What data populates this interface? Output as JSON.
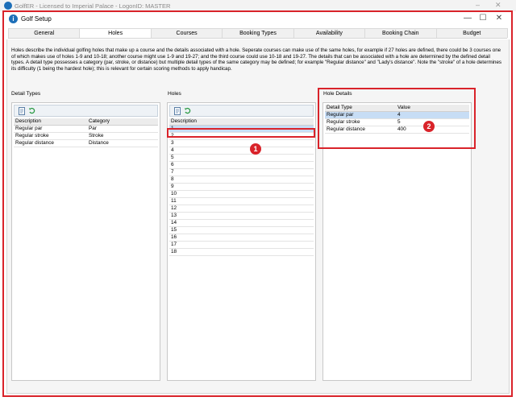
{
  "background_window": {
    "title": "GolfER - Licensed to Imperial Palace - LogonID: MASTER"
  },
  "window": {
    "title": "Golf Setup",
    "controls": {
      "minimize": "—",
      "maximize": "☐",
      "close": "✕"
    }
  },
  "tabs": [
    {
      "label": "General",
      "active": false
    },
    {
      "label": "Holes",
      "active": true
    },
    {
      "label": "Courses",
      "active": false
    },
    {
      "label": "Booking Types",
      "active": false
    },
    {
      "label": "Availability",
      "active": false
    },
    {
      "label": "Booking Chain",
      "active": false
    },
    {
      "label": "Budget",
      "active": false
    }
  ],
  "description": "Holes describe the individual golfing holes that make up a course and the details associated with a hole. Seperate courses can make use of the same holes, for example if 27 holes are defined, there could be 3 courses one of which makes use of holes 1-9 and 10-18; another course might use 1-9 and 19-27; and the third course could use 10-18 and 19-27. The details that can be associated with a hole are determined by the defined detail types. A detail type possesses a category (par, stroke, or distance) but multiple detail types of the same category may be defined; for example \"Regular distance\" and \"Lady's distance\". Note the \"stroke\" of a hole determines its difficulty (1 being the hardest hole); this is relevant for certain scoring methods to apply handicap.",
  "detail_types": {
    "label": "Detail Types",
    "columns": [
      "Description",
      "Category"
    ],
    "rows": [
      [
        "Regular par",
        "Par"
      ],
      [
        "Regular stroke",
        "Stroke"
      ],
      [
        "Regular distance",
        "Distance"
      ]
    ]
  },
  "holes": {
    "label": "Holes",
    "column": "Description",
    "rows": [
      "1",
      "2",
      "3",
      "4",
      "5",
      "6",
      "7",
      "8",
      "9",
      "10",
      "11",
      "12",
      "13",
      "14",
      "15",
      "16",
      "17",
      "18"
    ],
    "selected_index": 0
  },
  "hole_details": {
    "label": "Hole Details",
    "columns": [
      "Detail Type",
      "Value"
    ],
    "rows": [
      [
        "Regular par",
        "4"
      ],
      [
        "Regular stroke",
        "5"
      ],
      [
        "Regular distance",
        "400"
      ]
    ],
    "selected_index": 0
  },
  "callouts": {
    "holes": "1",
    "details": "2"
  },
  "colors": {
    "highlight": "#d9232a",
    "selection": "#c7ddf5",
    "app_icon": "#1d6fb8"
  }
}
